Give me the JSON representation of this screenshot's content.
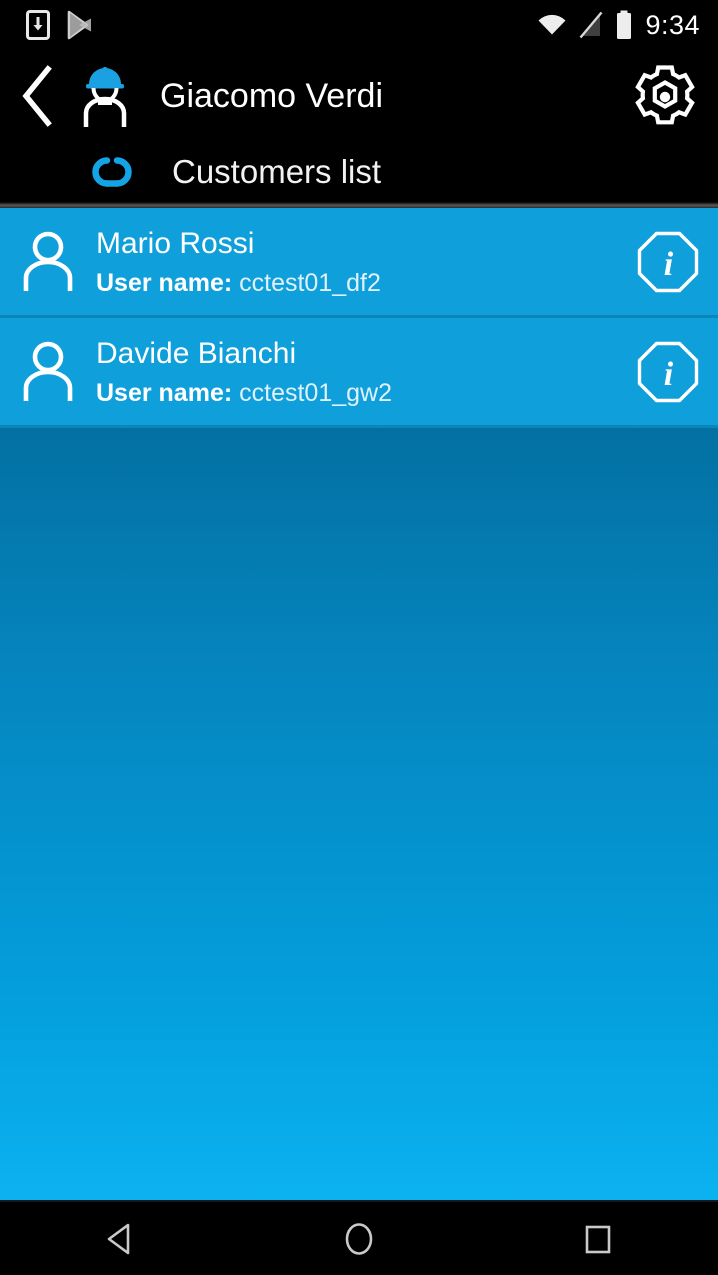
{
  "status_bar": {
    "icons": [
      {
        "name": "app-download-icon",
        "label": "download-to-phone"
      },
      {
        "name": "play-store-icon",
        "label": "play-store"
      },
      {
        "name": "wifi-icon",
        "label": "wifi-connected"
      },
      {
        "name": "no-sim-icon",
        "label": "no-signal"
      },
      {
        "name": "battery-icon",
        "label": "battery-full"
      }
    ],
    "clock": "9:34"
  },
  "header": {
    "back_label": "Back",
    "avatar_icon": "worker-helmet-icon",
    "title": "Giacomo Verdi",
    "settings_label": "Settings",
    "section_icon": "linked-rings-icon",
    "section_title": "Customers list"
  },
  "customers": [
    {
      "name": "Mario Rossi",
      "username_label": "User name:",
      "username_value": "cctest01_df2",
      "info_label": "i"
    },
    {
      "name": "Davide Bianchi",
      "username_label": "User name:",
      "username_value": "cctest01_gw2",
      "info_label": "i"
    }
  ],
  "nav_bar": {
    "back": "back-triangle",
    "home": "home-circle",
    "recents": "recents-square"
  },
  "colors": {
    "header_bg": "#000000",
    "row_bg": "#0f9fdb",
    "row_divider": "#0c86b9",
    "accent_blue": "#13a3e3",
    "bg_gradient_top": "#015d88",
    "bg_gradient_bottom": "#0cb2f0",
    "text_primary": "#ffffff",
    "text_secondary": "#dff1fb"
  }
}
